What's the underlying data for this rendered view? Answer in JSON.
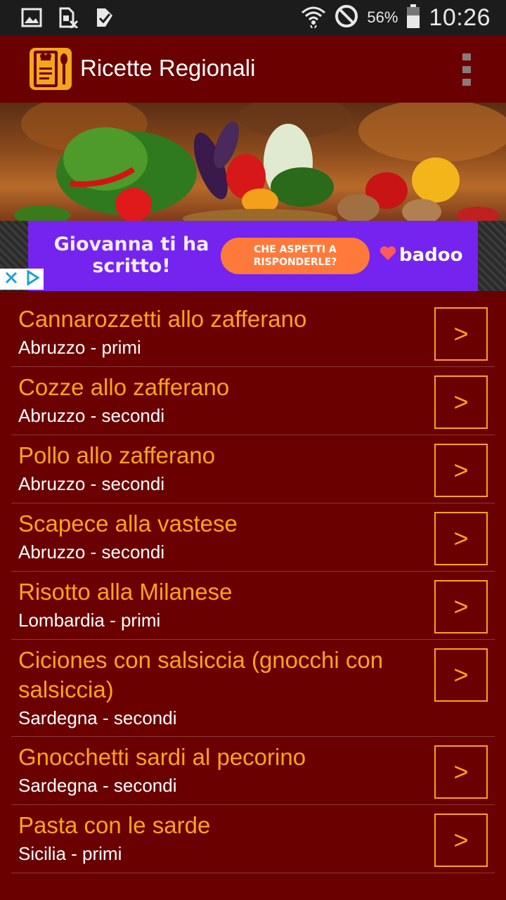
{
  "status_bar": {
    "battery_percent": "56%",
    "time": "10:26",
    "icons": [
      "gallery-icon",
      "sim-off-icon",
      "task-check-icon",
      "wifi-icon",
      "do-not-disturb-icon",
      "battery-icon"
    ]
  },
  "app_bar": {
    "title": "Ricette Regionali",
    "logo_icon": "chef-recipe-icon",
    "menu_icon": "overflow-menu-icon"
  },
  "ad": {
    "headline": "Giovanna ti ha scritto!",
    "cta": "CHE ASPETTI A RISPONDERLE?",
    "brand": "badoo",
    "accent": "#7424ee",
    "cta_color": "#ff7a3a"
  },
  "colors": {
    "background": "#6a0000",
    "title": "#ffa21a",
    "subtitle": "#ffffff"
  },
  "recipes": [
    {
      "title": "Cannarozzetti allo zafferano",
      "subtitle": "Abruzzo - primi",
      "button": ">"
    },
    {
      "title": "Cozze allo zafferano",
      "subtitle": "Abruzzo - secondi",
      "button": ">"
    },
    {
      "title": "Pollo allo zafferano",
      "subtitle": "Abruzzo - secondi",
      "button": ">"
    },
    {
      "title": "Scapece alla vastese",
      "subtitle": "Abruzzo - secondi",
      "button": ">"
    },
    {
      "title": "Risotto alla Milanese",
      "subtitle": "Lombardia - primi",
      "button": ">"
    },
    {
      "title": "Ciciones con salsiccia (gnocchi con salsiccia)",
      "subtitle": "Sardegna - secondi",
      "button": ">"
    },
    {
      "title": "Gnocchetti sardi al pecorino",
      "subtitle": "Sardegna - secondi",
      "button": ">"
    },
    {
      "title": "Pasta con le sarde",
      "subtitle": "Sicilia - primi",
      "button": ">"
    }
  ]
}
